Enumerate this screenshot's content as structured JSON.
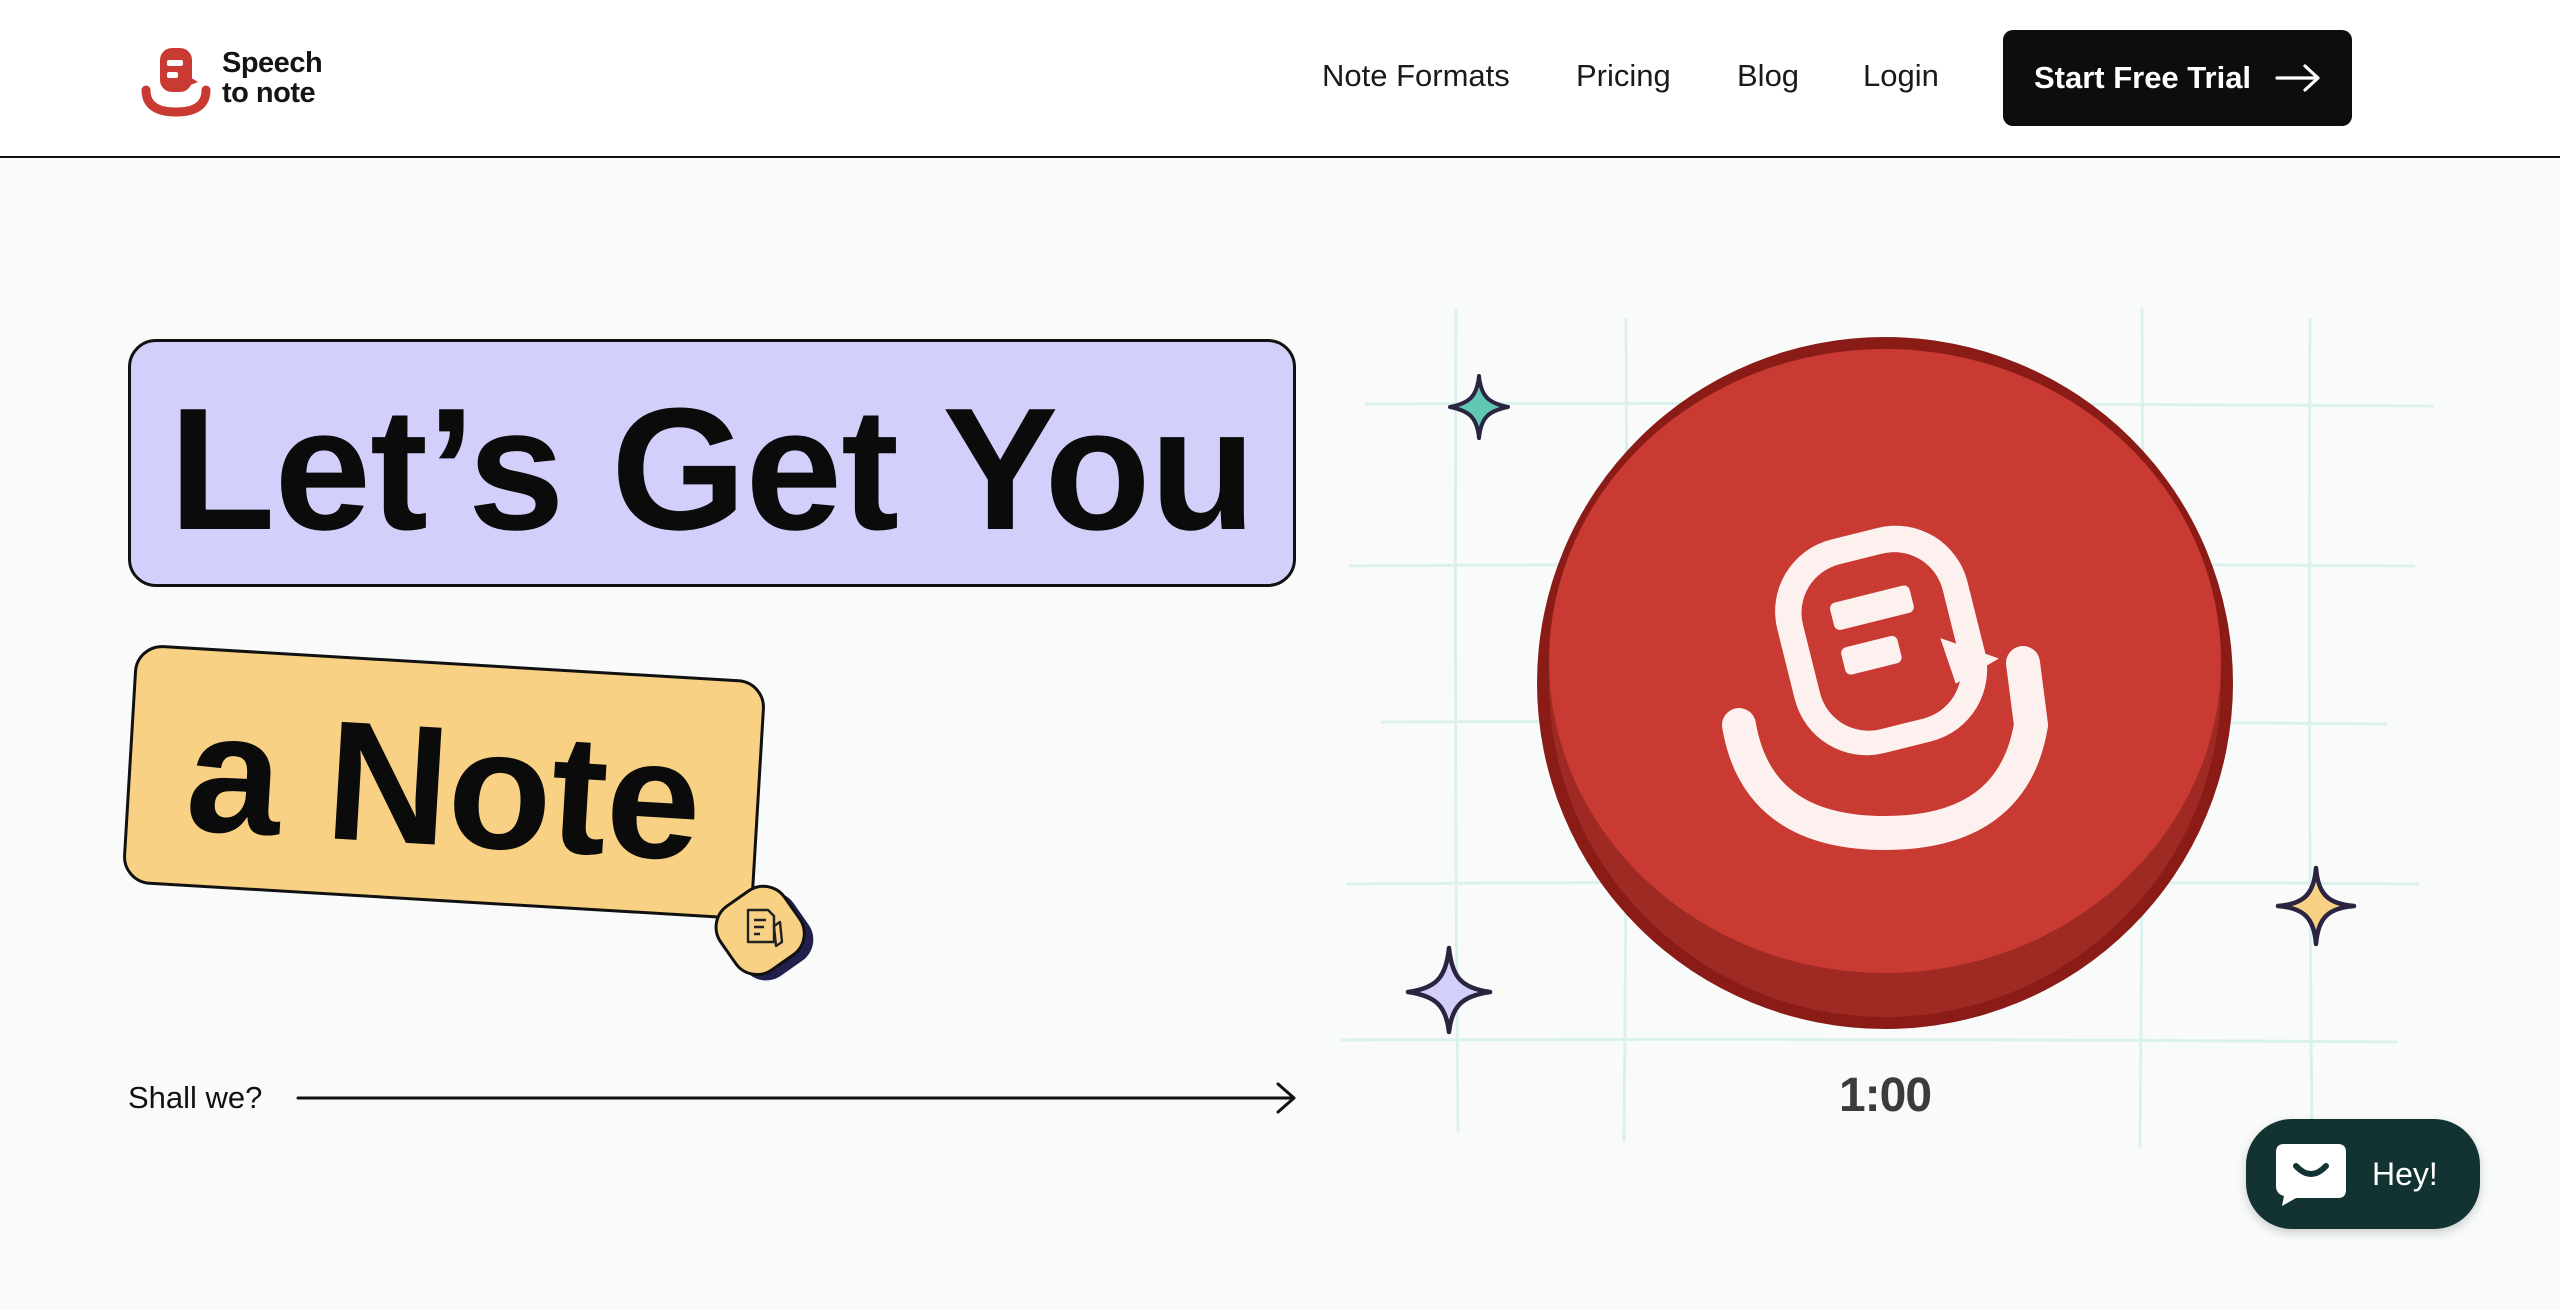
{
  "header": {
    "logo": {
      "line1": "Speech",
      "line2": "to note"
    },
    "nav": [
      {
        "label": "Note Formats"
      },
      {
        "label": "Pricing"
      },
      {
        "label": "Blog"
      },
      {
        "label": "Login"
      }
    ],
    "cta_label": "Start Free Trial"
  },
  "hero": {
    "headline_line1": "Let’s Get You",
    "headline_line2": "a Note",
    "shall_we": "Shall we?",
    "timer": "1:00"
  },
  "chat": {
    "label": "Hey!"
  },
  "colors": {
    "brand_red": "#c93a32",
    "headline_purple": "#d2d0fb",
    "headline_yellow": "#f8d185",
    "chat_bg": "#133332"
  },
  "icons": {
    "logo": "speech-to-note-logo-icon",
    "arrow": "arrow-right-icon",
    "badge": "note-pen-icon",
    "record": "record-mic-icon",
    "chat": "chat-smile-icon",
    "sparkle": "sparkle-icon"
  }
}
